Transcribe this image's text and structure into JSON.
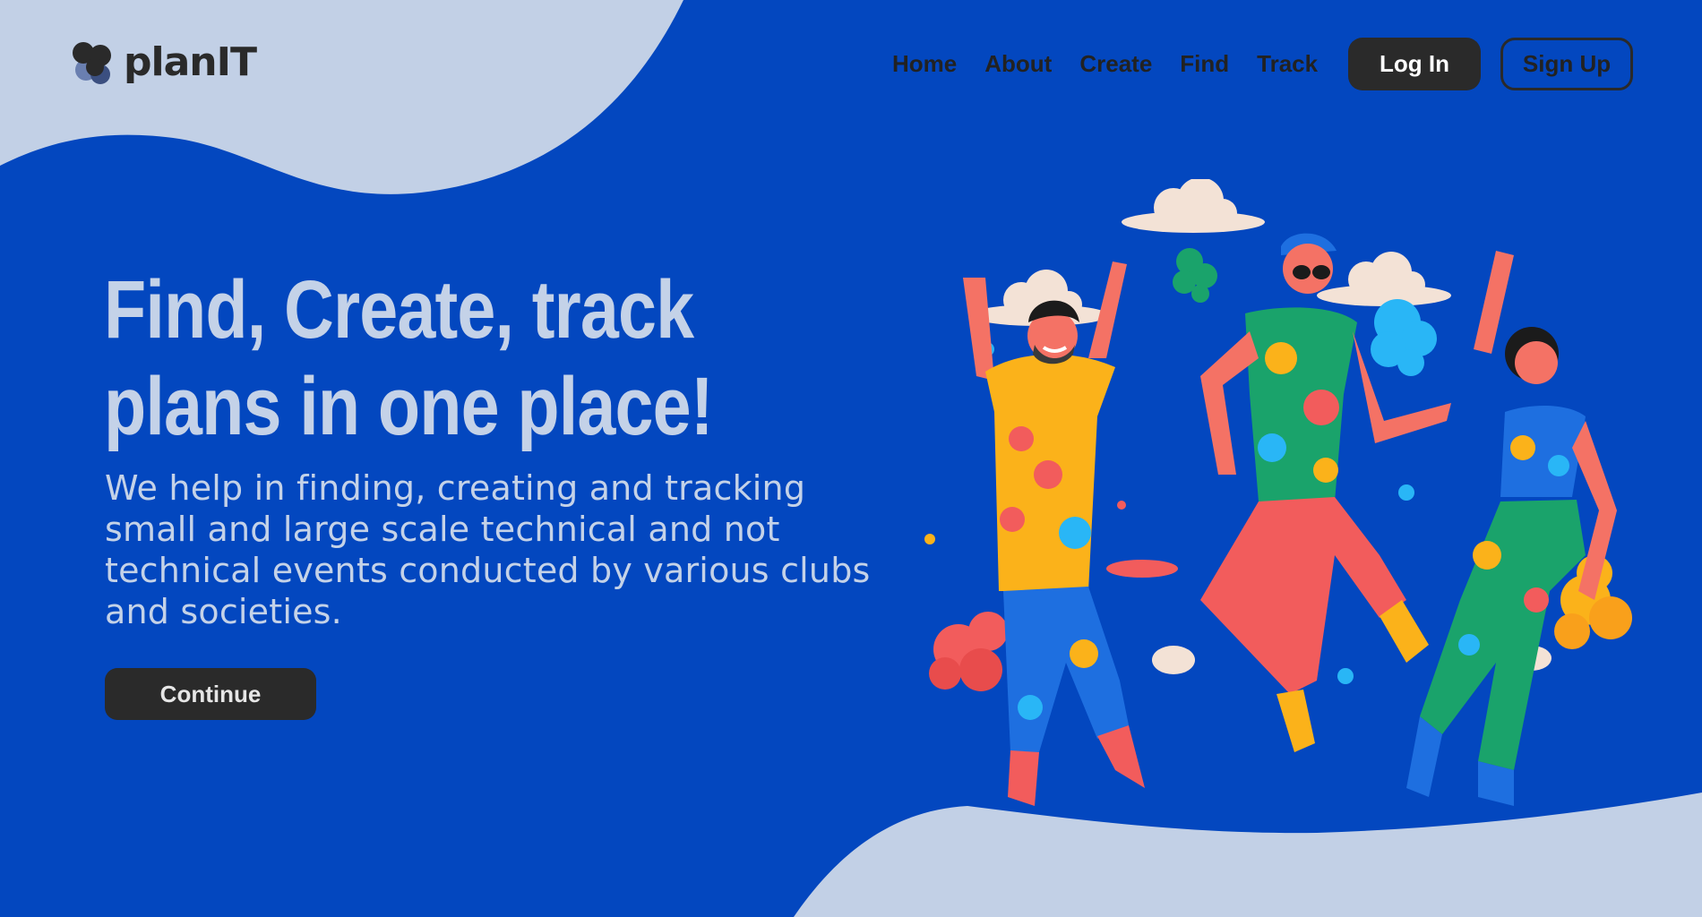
{
  "brand": {
    "name": "planIT"
  },
  "nav": {
    "items": [
      "Home",
      "About",
      "Create",
      "Find",
      "Track"
    ],
    "login_label": "Log In",
    "signup_label": "Sign Up"
  },
  "hero": {
    "title_line1": "Find, Create, track",
    "title_line2": "plans in one place!",
    "description": "We help in finding, creating and tracking small and large scale technical and not technical events conducted by various clubs and societies.",
    "cta_label": "Continue"
  },
  "colors": {
    "background": "#0347BF",
    "blob": "#C2D0E6",
    "hero_text": "#C4D2E8",
    "button_dark": "#2A2A2A"
  },
  "illustration": {
    "icon": "three-dancing-people-illustration"
  }
}
